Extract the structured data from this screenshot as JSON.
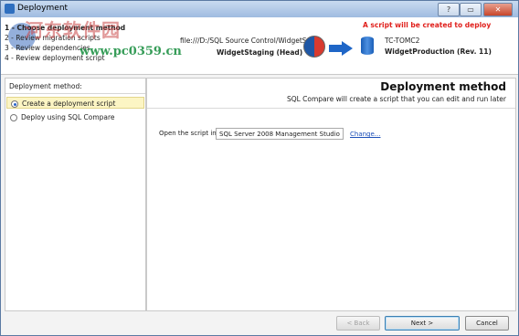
{
  "window": {
    "title": "Deployment"
  },
  "steps": [
    {
      "label": "1 - Choose deployment method",
      "current": true
    },
    {
      "label": "2 - Review migration scripts",
      "current": false
    },
    {
      "label": "3 - Review dependencies",
      "current": false
    },
    {
      "label": "4 - Review deployment script",
      "current": false
    }
  ],
  "watermark": {
    "line1": "河东软件园",
    "line2": "www.pc0359.cn"
  },
  "header": {
    "notice": "A script will be created to deploy",
    "source_path": "file:///D:/SQL Source Control/WidgetS...",
    "source_name": "WidgetStaging (Head)",
    "target_server": "TC-TOMC2",
    "target_name": "WidgetProduction (Rev. 11)"
  },
  "left": {
    "heading": "Deployment method:",
    "options": [
      {
        "label": "Create a deployment script",
        "selected": true
      },
      {
        "label": "Deploy using SQL Compare",
        "selected": false
      }
    ]
  },
  "main": {
    "title": "Deployment method",
    "subtitle": "SQL Compare will create a script that you can edit and run later",
    "open_label": "Open the script in:",
    "open_value": "SQL Server 2008 Management Studio",
    "change_link": "Change..."
  },
  "footer": {
    "back": "< Back",
    "next": "Next >",
    "cancel": "Cancel"
  },
  "colors": {
    "accent": "#1f66c7",
    "notice": "#e0201c",
    "selection": "#fcf5c4"
  }
}
